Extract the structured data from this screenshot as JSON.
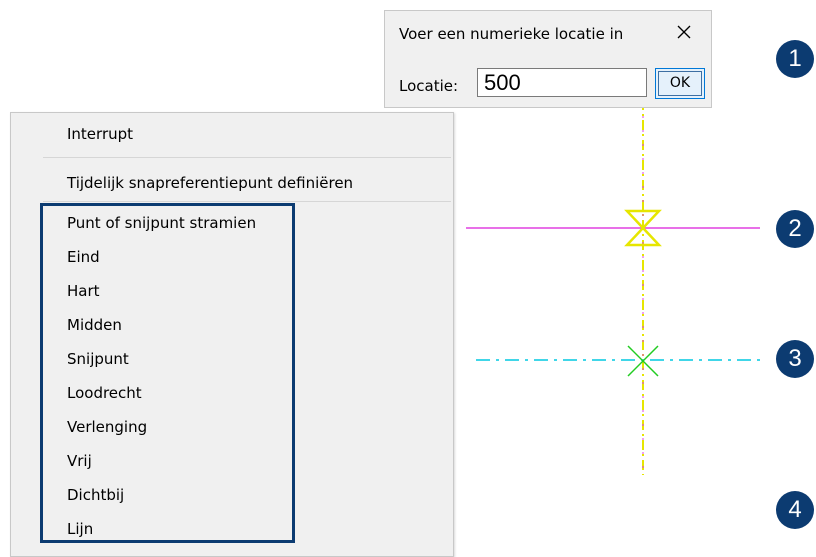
{
  "dialog": {
    "title": "Voer een numerieke locatie in",
    "location_label": "Locatie:",
    "location_value": "500",
    "ok_label": "OK"
  },
  "context_menu": {
    "items": [
      "Interrupt",
      "Tijdelijk snapreferentiepunt definiëren",
      "Punt of snijpunt stramien",
      "Eind",
      "Hart",
      "Midden",
      "Snijpunt",
      "Loodrecht",
      "Verlenging",
      "Vrij",
      "Dichtbij",
      "Lijn"
    ]
  },
  "steps": [
    "1",
    "2",
    "3",
    "4"
  ],
  "colors": {
    "magenta_line": "#e040e0",
    "yellow_line": "#e6e600",
    "cyan_line": "#00c8e0",
    "green_marker": "#22cc22",
    "badge": "#0c3b71"
  }
}
